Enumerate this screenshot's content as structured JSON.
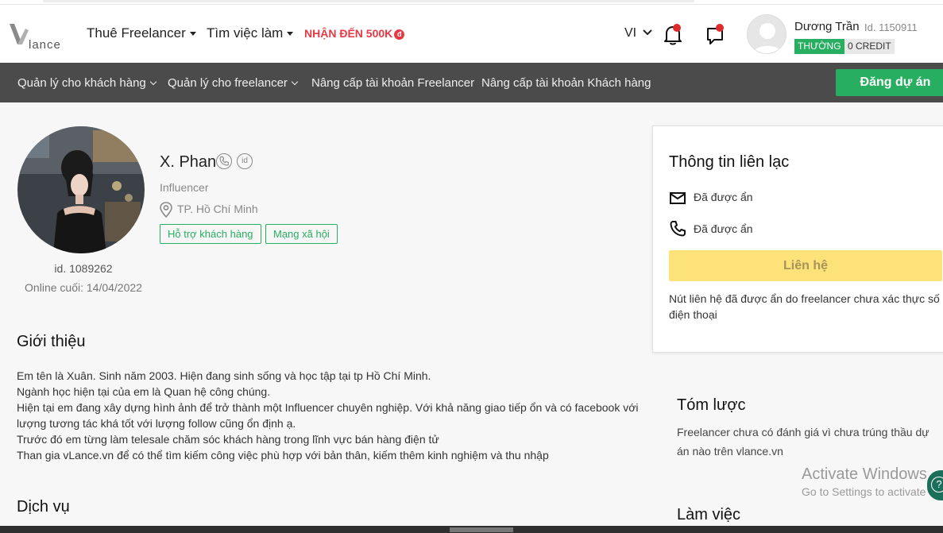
{
  "header": {
    "logo_text": "lance",
    "nav": [
      {
        "label": "Thuê Freelancer"
      },
      {
        "label": "Tìm việc làm"
      }
    ],
    "promo": {
      "label": "NHẬN ĐẾN 500K",
      "badge": "đ"
    },
    "language": "VI",
    "user": {
      "name": "Dương Trần",
      "id": "Id. 1150911",
      "tier": "THƯỜNG",
      "credit": "0 CREDIT"
    }
  },
  "menubar": {
    "items": [
      {
        "label": "Quản lý cho khách hàng"
      },
      {
        "label": "Quản lý cho freelancer"
      },
      {
        "label": "Nâng cấp tài khoản Freelancer"
      },
      {
        "label": "Nâng cấp tài khoản Khách hàng"
      }
    ],
    "post_button": "Đăng dự án"
  },
  "profile": {
    "name": "X. Phan",
    "id_badge": "id",
    "role": "Influencer",
    "location": "TP. Hồ Chí Minh",
    "skills": [
      "Hỗ trợ khách hàng",
      "Mạng xã hội"
    ],
    "id_text": "id. 1089262",
    "online_text": "Online cuối: 14/04/2022"
  },
  "intro": {
    "heading": "Giới thiệu",
    "lines": [
      "Em tên là Xuân. Sinh năm 2003. Hiện đang sinh sống và học tập tại tp Hồ Chí Minh.",
      "Ngành học hiện tại của em là Quan hệ công chúng.",
      "Hiện tại em đang xây dựng hình ảnh để trở thành một Influencer chuyên nghiệp. Với khả năng giao tiếp ổn và có facebook với lượng tương tác khá tốt với lượng follow cũng ổn định ạ.",
      "Trước đó em từng làm telesale chăm sóc khách hàng trong lĩnh vực bán hàng điện tử",
      "Than gia vLance.vn để có thể tìm kiếm công việc phù hợp với bản thân, kiếm thêm kinh nghiệm và thu nhập"
    ]
  },
  "services": {
    "heading": "Dịch vụ"
  },
  "contact": {
    "title": "Thông tin liên lạc",
    "email": "Đã được ẩn",
    "phone": "Đã được ẩn",
    "button": "Liên hệ",
    "note": "Nút liên hệ đã được ẩn do freelancer chưa xác thực số điện thoại"
  },
  "summary": {
    "heading": "Tóm lược",
    "text": "Freelancer chưa có đánh giá vì chưa trúng thầu dự án nào trên vlance.vn"
  },
  "work": {
    "heading": "Làm việc"
  },
  "watermark": {
    "line1": "Activate Windows",
    "line2": "Go to Settings to activate Windows."
  },
  "help_button": "?"
}
